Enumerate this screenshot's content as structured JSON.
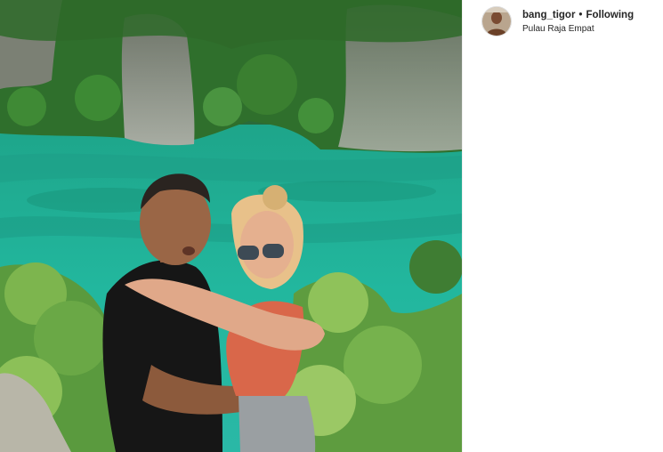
{
  "post": {
    "username": "bang_tigor",
    "separator": "•",
    "follow_status": "Following",
    "location": "Pulau Raja Empat"
  },
  "colors": {
    "text": "#262626",
    "lagoon": "#23b5a0",
    "border": "#efefef"
  },
  "icons": {
    "avatar": "profile-photo"
  }
}
